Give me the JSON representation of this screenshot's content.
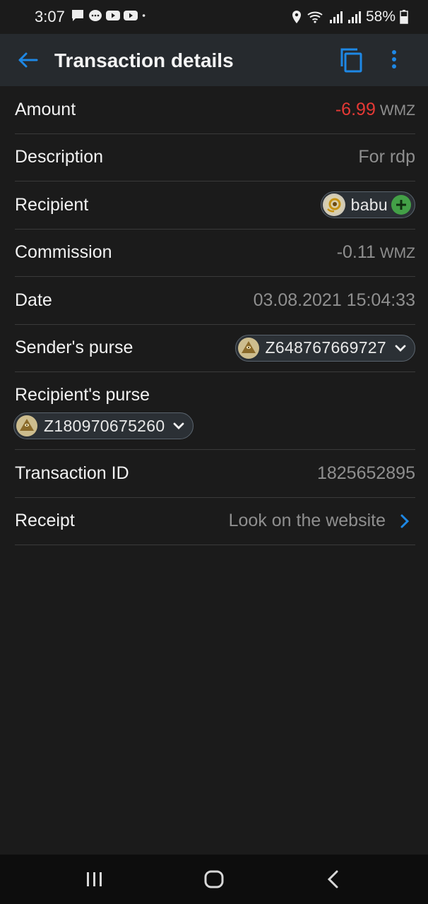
{
  "status_bar": {
    "time": "3:07",
    "battery": "58%",
    "notification_icons": [
      "message-icon",
      "chat-bubble-icon",
      "youtube-icon",
      "youtube-icon",
      "dot-icon"
    ],
    "right_icons": [
      "location-icon",
      "wifi-icon",
      "signal-icon",
      "signal-icon",
      "battery-icon"
    ]
  },
  "app_bar": {
    "title": "Transaction details"
  },
  "rows": {
    "amount": {
      "label": "Amount",
      "value": "-6.99",
      "unit": "WMZ"
    },
    "description": {
      "label": "Description",
      "value": "For rdp"
    },
    "recipient": {
      "label": "Recipient",
      "name": "babu"
    },
    "commission": {
      "label": "Commission",
      "value": "-0.11",
      "unit": "WMZ"
    },
    "date": {
      "label": "Date",
      "value": "03.08.2021 15:04:33"
    },
    "sender_purse": {
      "label": "Sender's purse",
      "value": "Z648767669727"
    },
    "recipient_purse": {
      "label": "Recipient's purse",
      "value": "Z180970675260"
    },
    "transaction_id": {
      "label": "Transaction ID",
      "value": "1825652895"
    },
    "receipt": {
      "label": "Receipt",
      "value": "Look on the website"
    }
  },
  "colors": {
    "accent": "#1e88e5",
    "negative": "#e53935",
    "add": "#43a047"
  }
}
